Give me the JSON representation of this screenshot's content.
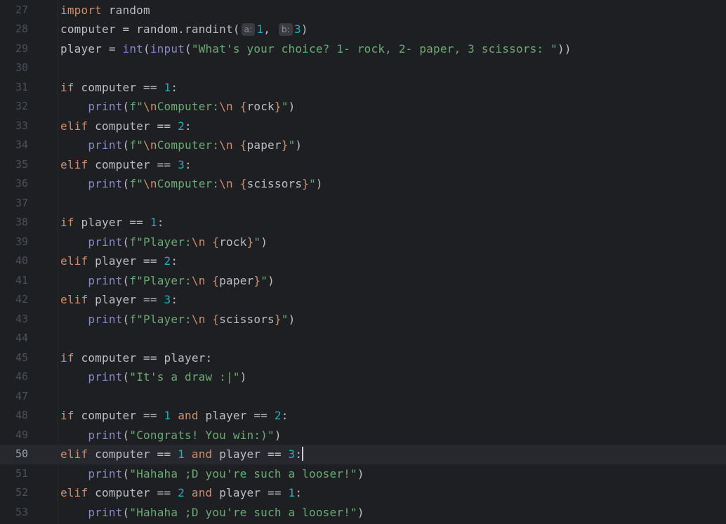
{
  "editor": {
    "lines": [
      {
        "num": "27",
        "tokens": [
          {
            "c": "kw",
            "t": "import"
          },
          {
            "c": "txt",
            "t": " random"
          }
        ]
      },
      {
        "num": "28",
        "tokens": [
          {
            "c": "txt",
            "t": "computer = random.randint("
          },
          {
            "c": "hint",
            "t": "a:"
          },
          {
            "c": "num",
            "t": "1"
          },
          {
            "c": "txt",
            "t": ", "
          },
          {
            "c": "hint",
            "t": "b:"
          },
          {
            "c": "num",
            "t": "3"
          },
          {
            "c": "txt",
            "t": ")"
          }
        ]
      },
      {
        "num": "29",
        "tokens": [
          {
            "c": "txt",
            "t": "player = "
          },
          {
            "c": "bi",
            "t": "int"
          },
          {
            "c": "txt",
            "t": "("
          },
          {
            "c": "bi",
            "t": "input"
          },
          {
            "c": "txt",
            "t": "("
          },
          {
            "c": "str",
            "t": "\"What's your choice? 1- rock, 2- paper, 3 scissors: \""
          },
          {
            "c": "txt",
            "t": "))"
          }
        ]
      },
      {
        "num": "30",
        "tokens": []
      },
      {
        "num": "31",
        "tokens": [
          {
            "c": "kw",
            "t": "if"
          },
          {
            "c": "txt",
            "t": " computer == "
          },
          {
            "c": "num",
            "t": "1"
          },
          {
            "c": "txt",
            "t": ":"
          }
        ]
      },
      {
        "num": "32",
        "tokens": [
          {
            "c": "txt",
            "t": "    "
          },
          {
            "c": "bi",
            "t": "print"
          },
          {
            "c": "txt",
            "t": "("
          },
          {
            "c": "str",
            "t": "f\""
          },
          {
            "c": "esc",
            "t": "\\n"
          },
          {
            "c": "str",
            "t": "Computer:"
          },
          {
            "c": "esc",
            "t": "\\n"
          },
          {
            "c": "str",
            "t": " "
          },
          {
            "c": "brace",
            "t": "{"
          },
          {
            "c": "var",
            "t": "rock"
          },
          {
            "c": "brace",
            "t": "}"
          },
          {
            "c": "str",
            "t": "\""
          },
          {
            "c": "txt",
            "t": ")"
          }
        ]
      },
      {
        "num": "33",
        "tokens": [
          {
            "c": "kw",
            "t": "elif"
          },
          {
            "c": "txt",
            "t": " computer == "
          },
          {
            "c": "num",
            "t": "2"
          },
          {
            "c": "txt",
            "t": ":"
          }
        ]
      },
      {
        "num": "34",
        "tokens": [
          {
            "c": "txt",
            "t": "    "
          },
          {
            "c": "bi",
            "t": "print"
          },
          {
            "c": "txt",
            "t": "("
          },
          {
            "c": "str",
            "t": "f\""
          },
          {
            "c": "esc",
            "t": "\\n"
          },
          {
            "c": "str",
            "t": "Computer:"
          },
          {
            "c": "esc",
            "t": "\\n"
          },
          {
            "c": "str",
            "t": " "
          },
          {
            "c": "brace",
            "t": "{"
          },
          {
            "c": "var",
            "t": "paper"
          },
          {
            "c": "brace",
            "t": "}"
          },
          {
            "c": "str",
            "t": "\""
          },
          {
            "c": "txt",
            "t": ")"
          }
        ]
      },
      {
        "num": "35",
        "tokens": [
          {
            "c": "kw",
            "t": "elif"
          },
          {
            "c": "txt",
            "t": " computer == "
          },
          {
            "c": "num",
            "t": "3"
          },
          {
            "c": "txt",
            "t": ":"
          }
        ]
      },
      {
        "num": "36",
        "tokens": [
          {
            "c": "txt",
            "t": "    "
          },
          {
            "c": "bi",
            "t": "print"
          },
          {
            "c": "txt",
            "t": "("
          },
          {
            "c": "str",
            "t": "f\""
          },
          {
            "c": "esc",
            "t": "\\n"
          },
          {
            "c": "str",
            "t": "Computer:"
          },
          {
            "c": "esc",
            "t": "\\n"
          },
          {
            "c": "str",
            "t": " "
          },
          {
            "c": "brace",
            "t": "{"
          },
          {
            "c": "var",
            "t": "scissors"
          },
          {
            "c": "brace",
            "t": "}"
          },
          {
            "c": "str",
            "t": "\""
          },
          {
            "c": "txt",
            "t": ")"
          }
        ]
      },
      {
        "num": "37",
        "tokens": []
      },
      {
        "num": "38",
        "tokens": [
          {
            "c": "kw",
            "t": "if"
          },
          {
            "c": "txt",
            "t": " player == "
          },
          {
            "c": "num",
            "t": "1"
          },
          {
            "c": "txt",
            "t": ":"
          }
        ]
      },
      {
        "num": "39",
        "tokens": [
          {
            "c": "txt",
            "t": "    "
          },
          {
            "c": "bi",
            "t": "print"
          },
          {
            "c": "txt",
            "t": "("
          },
          {
            "c": "str",
            "t": "f\"Player:"
          },
          {
            "c": "esc",
            "t": "\\n"
          },
          {
            "c": "str",
            "t": " "
          },
          {
            "c": "brace",
            "t": "{"
          },
          {
            "c": "var",
            "t": "rock"
          },
          {
            "c": "brace",
            "t": "}"
          },
          {
            "c": "str",
            "t": "\""
          },
          {
            "c": "txt",
            "t": ")"
          }
        ]
      },
      {
        "num": "40",
        "tokens": [
          {
            "c": "kw",
            "t": "elif"
          },
          {
            "c": "txt",
            "t": " player == "
          },
          {
            "c": "num",
            "t": "2"
          },
          {
            "c": "txt",
            "t": ":"
          }
        ]
      },
      {
        "num": "41",
        "tokens": [
          {
            "c": "txt",
            "t": "    "
          },
          {
            "c": "bi",
            "t": "print"
          },
          {
            "c": "txt",
            "t": "("
          },
          {
            "c": "str",
            "t": "f\"Player:"
          },
          {
            "c": "esc",
            "t": "\\n"
          },
          {
            "c": "str",
            "t": " "
          },
          {
            "c": "brace",
            "t": "{"
          },
          {
            "c": "var",
            "t": "paper"
          },
          {
            "c": "brace",
            "t": "}"
          },
          {
            "c": "str",
            "t": "\""
          },
          {
            "c": "txt",
            "t": ")"
          }
        ]
      },
      {
        "num": "42",
        "tokens": [
          {
            "c": "kw",
            "t": "elif"
          },
          {
            "c": "txt",
            "t": " player == "
          },
          {
            "c": "num",
            "t": "3"
          },
          {
            "c": "txt",
            "t": ":"
          }
        ]
      },
      {
        "num": "43",
        "tokens": [
          {
            "c": "txt",
            "t": "    "
          },
          {
            "c": "bi",
            "t": "print"
          },
          {
            "c": "txt",
            "t": "("
          },
          {
            "c": "str",
            "t": "f\"Player:"
          },
          {
            "c": "esc",
            "t": "\\n"
          },
          {
            "c": "str",
            "t": " "
          },
          {
            "c": "brace",
            "t": "{"
          },
          {
            "c": "var",
            "t": "scissors"
          },
          {
            "c": "brace",
            "t": "}"
          },
          {
            "c": "str",
            "t": "\""
          },
          {
            "c": "txt",
            "t": ")"
          }
        ]
      },
      {
        "num": "44",
        "tokens": []
      },
      {
        "num": "45",
        "tokens": [
          {
            "c": "kw",
            "t": "if"
          },
          {
            "c": "txt",
            "t": " computer == player:"
          }
        ]
      },
      {
        "num": "46",
        "tokens": [
          {
            "c": "txt",
            "t": "    "
          },
          {
            "c": "bi",
            "t": "print"
          },
          {
            "c": "txt",
            "t": "("
          },
          {
            "c": "str",
            "t": "\"It's a draw :|\""
          },
          {
            "c": "txt",
            "t": ")"
          }
        ]
      },
      {
        "num": "47",
        "tokens": []
      },
      {
        "num": "48",
        "tokens": [
          {
            "c": "kw",
            "t": "if"
          },
          {
            "c": "txt",
            "t": " computer == "
          },
          {
            "c": "num",
            "t": "1"
          },
          {
            "c": "txt",
            "t": " "
          },
          {
            "c": "kw",
            "t": "and"
          },
          {
            "c": "txt",
            "t": " player == "
          },
          {
            "c": "num",
            "t": "2"
          },
          {
            "c": "txt",
            "t": ":"
          }
        ]
      },
      {
        "num": "49",
        "tokens": [
          {
            "c": "txt",
            "t": "    "
          },
          {
            "c": "bi",
            "t": "print"
          },
          {
            "c": "txt",
            "t": "("
          },
          {
            "c": "str",
            "t": "\"Congrats! You win:)\""
          },
          {
            "c": "txt",
            "t": ")"
          }
        ]
      },
      {
        "num": "50",
        "current": true,
        "tokens": [
          {
            "c": "kw",
            "t": "elif"
          },
          {
            "c": "txt",
            "t": " computer == "
          },
          {
            "c": "num",
            "t": "1"
          },
          {
            "c": "txt",
            "t": " "
          },
          {
            "c": "kw",
            "t": "and"
          },
          {
            "c": "txt",
            "t": " player == "
          },
          {
            "c": "num",
            "t": "3"
          },
          {
            "c": "txt",
            "t": ":"
          }
        ]
      },
      {
        "num": "51",
        "tokens": [
          {
            "c": "txt",
            "t": "    "
          },
          {
            "c": "bi",
            "t": "print"
          },
          {
            "c": "txt",
            "t": "("
          },
          {
            "c": "str",
            "t": "\"Hahaha ;D you're such a looser!\""
          },
          {
            "c": "txt",
            "t": ")"
          }
        ]
      },
      {
        "num": "52",
        "tokens": [
          {
            "c": "kw",
            "t": "elif"
          },
          {
            "c": "txt",
            "t": " computer == "
          },
          {
            "c": "num",
            "t": "2"
          },
          {
            "c": "txt",
            "t": " "
          },
          {
            "c": "kw",
            "t": "and"
          },
          {
            "c": "txt",
            "t": " player == "
          },
          {
            "c": "num",
            "t": "1"
          },
          {
            "c": "txt",
            "t": ":"
          }
        ]
      },
      {
        "num": "53",
        "tokens": [
          {
            "c": "txt",
            "t": "    "
          },
          {
            "c": "bi",
            "t": "print"
          },
          {
            "c": "txt",
            "t": "("
          },
          {
            "c": "str",
            "t": "\"Hahaha ;D you're such a looser!\""
          },
          {
            "c": "txt",
            "t": ")"
          }
        ]
      }
    ]
  }
}
